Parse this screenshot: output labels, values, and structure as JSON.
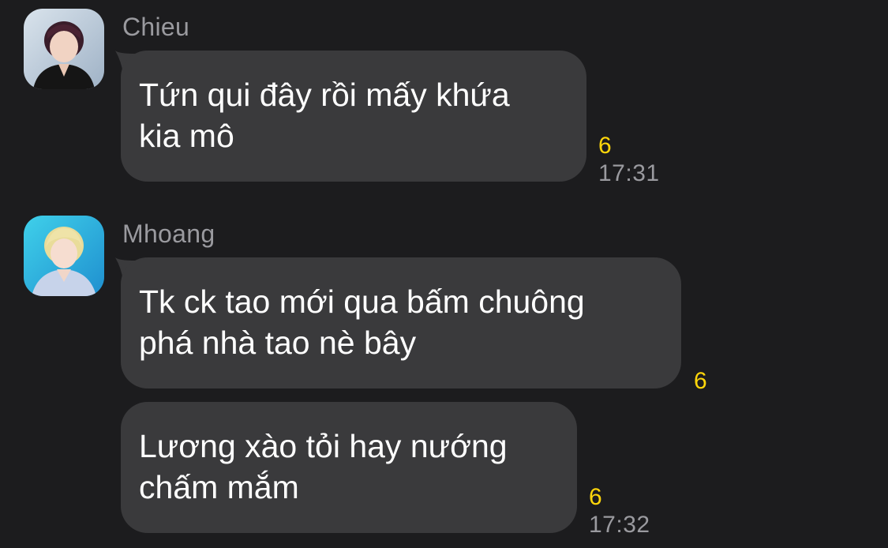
{
  "messages": [
    {
      "sender": "Chieu",
      "avatar": "chieu-avatar",
      "text": "Tứn qui đây rồi mấy khứa\nkia mô",
      "count": "6",
      "time": "17:31"
    },
    {
      "sender": "Mhoang",
      "avatar": "mhoang-avatar",
      "text": "Tk ck tao mới qua bấm chuông\nphá nhà tao nè bây",
      "count": "6"
    },
    {
      "text": "Lương xào tỏi hay nướng\nchấm mắm",
      "count": "6",
      "time": "17:32"
    }
  ],
  "colors": {
    "background": "#1c1c1e",
    "bubble": "#3a3a3c",
    "sender": "#9a9a9f",
    "count": "#ffd60a"
  }
}
